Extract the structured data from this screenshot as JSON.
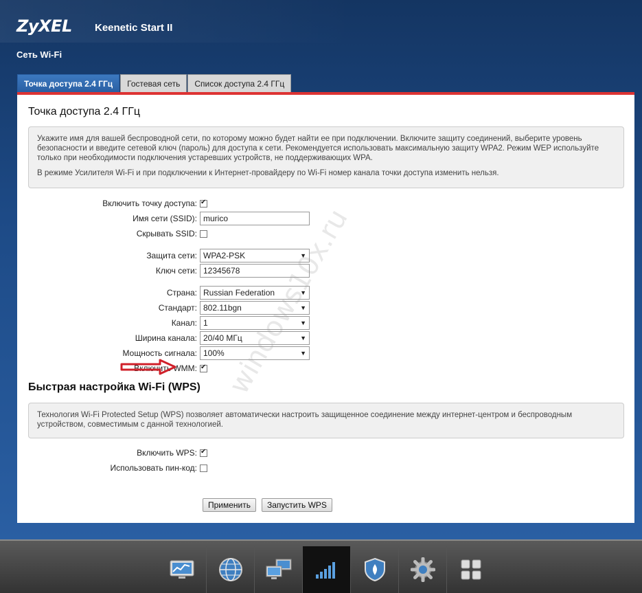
{
  "header": {
    "brand": "ZyXEL",
    "model": "Keenetic Start II",
    "section_title": "Сеть Wi-Fi"
  },
  "tabs": [
    {
      "label": "Точка доступа 2.4 ГГц",
      "active": true
    },
    {
      "label": "Гостевая сеть",
      "active": false
    },
    {
      "label": "Список доступа 2.4 ГГц",
      "active": false
    }
  ],
  "panel": {
    "title": "Точка доступа 2.4 ГГц",
    "info_p1": "Укажите имя для вашей беспроводной сети, по которому можно будет найти ее при подключении. Включите защиту соединений, выберите уровень безопасности и введите сетевой ключ (пароль) для доступа к сети. Рекомендуется использовать максимальную защиту WPA2. Режим WEP используйте только при необходимости подключения устаревших устройств, не поддерживающих WPA.",
    "info_p2": "В режиме Усилителя Wi-Fi и при подключении к Интернет-провайдеру по Wi-Fi номер канала точки доступа изменить нельзя."
  },
  "form": {
    "enable_ap_label": "Включить точку доступа:",
    "enable_ap_checked": true,
    "ssid_label": "Имя сети (SSID):",
    "ssid_value": "murico",
    "hide_ssid_label": "Скрывать SSID:",
    "hide_ssid_checked": false,
    "security_label": "Защита сети:",
    "security_value": "WPA2-PSK",
    "key_label": "Ключ сети:",
    "key_value": "12345678",
    "country_label": "Страна:",
    "country_value": "Russian Federation",
    "standard_label": "Стандарт:",
    "standard_value": "802.11bgn",
    "channel_label": "Канал:",
    "channel_value": "1",
    "width_label": "Ширина канала:",
    "width_value": "20/40 МГц",
    "power_label": "Мощность сигнала:",
    "power_value": "100%",
    "wmm_label": "Включить WMM:",
    "wmm_checked": true
  },
  "wps": {
    "title": "Быстрая настройка Wi-Fi (WPS)",
    "info": "Технология Wi-Fi Protected Setup (WPS) позволяет автоматически настроить защищенное соединение между интернет-центром и беспроводным устройством, совместимым с данной технологией.",
    "enable_label": "Включить WPS:",
    "enable_checked": true,
    "pin_label": "Использовать пин-код:",
    "pin_checked": false
  },
  "buttons": {
    "apply": "Применить",
    "start_wps": "Запустить WPS"
  },
  "watermark": "windows10x.ru",
  "bottom_nav": [
    {
      "icon": "monitor-chart-icon",
      "active": false
    },
    {
      "icon": "globe-icon",
      "active": false
    },
    {
      "icon": "network-computers-icon",
      "active": false
    },
    {
      "icon": "wifi-signal-bars-icon",
      "active": true
    },
    {
      "icon": "shield-icon",
      "active": false
    },
    {
      "icon": "gear-icon",
      "active": false
    },
    {
      "icon": "grid-apps-icon",
      "active": false
    }
  ],
  "colors": {
    "accent_tab": "#2a5fa3",
    "red_line": "#dd3333",
    "arrow": "#d0202a"
  }
}
